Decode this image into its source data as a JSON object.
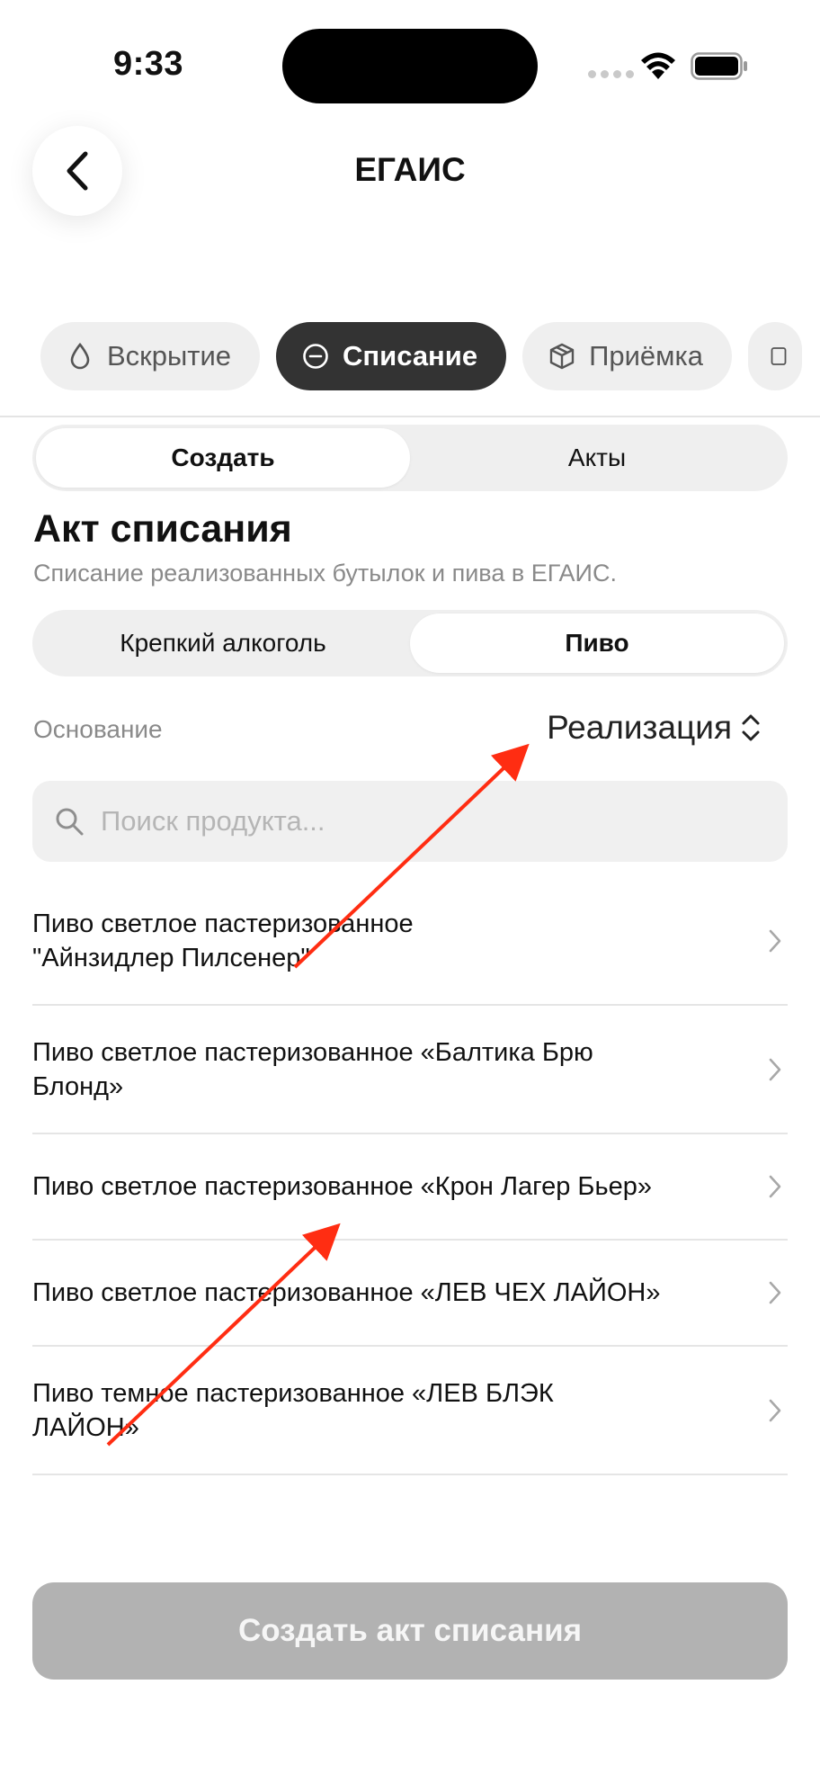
{
  "status_bar": {
    "time": "9:33"
  },
  "header": {
    "title": "ЕГАИС",
    "back_icon": "chevron-left-icon"
  },
  "categories": [
    {
      "label": "Вскрытие",
      "icon": "drop-icon",
      "active": false
    },
    {
      "label": "Списание",
      "icon": "minus-circle-icon",
      "active": true
    },
    {
      "label": "Приёмка",
      "icon": "box-icon",
      "active": false
    }
  ],
  "mode_tabs": {
    "create": "Создать",
    "acts": "Акты",
    "selected": "create"
  },
  "section": {
    "title": "Акт списания",
    "subtitle": "Списание реализованных бутылок и пива в ЕГАИС."
  },
  "type_tabs": {
    "strong": "Крепкий алкоголь",
    "beer": "Пиво",
    "selected": "beer"
  },
  "basis": {
    "label": "Основание",
    "value": "Реализация"
  },
  "search": {
    "placeholder": "Поиск продукта..."
  },
  "products": [
    {
      "name": "Пиво светлое пастеризованное \"Айнзидлер Пилсенер\""
    },
    {
      "name": "Пиво светлое пастеризованное «Балтика Брю Блонд»"
    },
    {
      "name": "Пиво светлое пастеризованное «Крон Лагер Бьер»"
    },
    {
      "name": "Пиво светлое пастеризованное «ЛЕВ ЧЕХ ЛАЙОН»"
    },
    {
      "name": "Пиво темное пастеризованное «ЛЕВ БЛЭК ЛАЙОН»"
    }
  ],
  "cta": {
    "label": "Создать акт списания"
  },
  "colors": {
    "active_chip": "#333333",
    "chip_bg": "#efefef",
    "disabled_button": "#b2b2b2",
    "annotation_arrow": "#ff2d12"
  }
}
